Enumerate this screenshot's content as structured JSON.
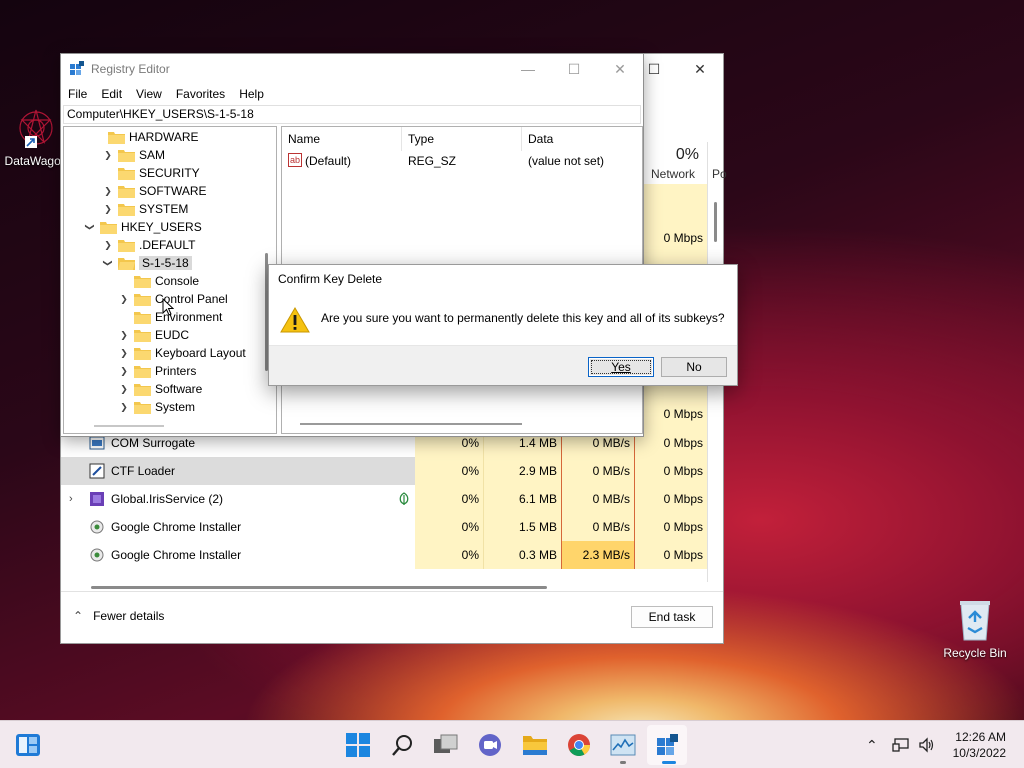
{
  "desktop": {
    "icons": [
      {
        "label": "DataWagon"
      },
      {
        "label": "Recycle Bin"
      }
    ]
  },
  "task_manager": {
    "net_percent": "0%",
    "col_network": "Network",
    "col_power": "Po",
    "rows": [
      {
        "name": "COM Surrogate",
        "cpu": "0%",
        "mem": "1.4 MB",
        "disk": "0 MB/s",
        "net": "0 Mbps"
      },
      {
        "name": "CTF Loader",
        "cpu": "0%",
        "mem": "2.9 MB",
        "disk": "0 MB/s",
        "net": "0 Mbps"
      },
      {
        "name": "Global.IrisService (2)",
        "cpu": "0%",
        "mem": "6.1 MB",
        "disk": "0 MB/s",
        "net": "0 Mbps"
      },
      {
        "name": "Google Chrome Installer",
        "cpu": "0%",
        "mem": "1.5 MB",
        "disk": "0 MB/s",
        "net": "0 Mbps"
      },
      {
        "name": "Google Chrome Installer",
        "cpu": "0%",
        "mem": "0.3 MB",
        "disk": "2.3 MB/s",
        "net": "0 Mbps"
      }
    ],
    "upper_net_values": [
      "0 Mbps",
      "0 Mbps",
      "0 Mbps",
      "0 Mbps"
    ],
    "fewer_details": "Fewer details",
    "end_task": "End task"
  },
  "registry": {
    "title": "Registry Editor",
    "menu": [
      "File",
      "Edit",
      "View",
      "Favorites",
      "Help"
    ],
    "address": "Computer\\HKEY_USERS\\S-1-5-18",
    "tree": {
      "hardware": "HARDWARE",
      "sam": "SAM",
      "security": "SECURITY",
      "software": "SOFTWARE",
      "system": "SYSTEM",
      "hkey_users": "HKEY_USERS",
      "default": ".DEFAULT",
      "s1518": "S-1-5-18",
      "console": "Console",
      "control_panel": "Control Panel",
      "environment": "Environment",
      "eudc": "EUDC",
      "keyboard_layout": "Keyboard Layout",
      "printers": "Printers",
      "software_sub": "Software",
      "system_sub": "System"
    },
    "columns": {
      "name": "Name",
      "type": "Type",
      "data": "Data"
    },
    "values": [
      {
        "name": "(Default)",
        "type": "REG_SZ",
        "data": "(value not set)",
        "icon": "ab"
      }
    ]
  },
  "dialog": {
    "title": "Confirm Key Delete",
    "message": "Are you sure you want to permanently delete this key and all of its subkeys?",
    "yes": "Yes",
    "no": "No"
  },
  "taskbar": {
    "time": "12:26 AM",
    "date": "10/3/2022"
  }
}
